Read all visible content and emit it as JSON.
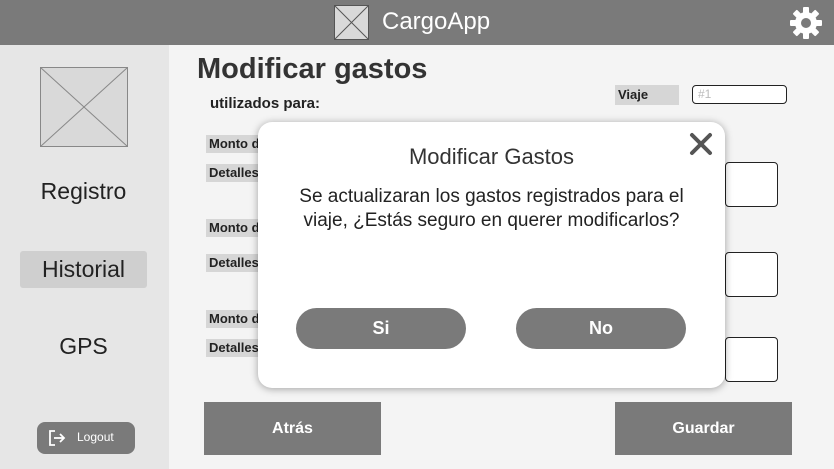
{
  "header": {
    "app_title": "CargoApp",
    "logo_icon": "image-placeholder-icon",
    "settings_icon": "gear-icon"
  },
  "sidebar": {
    "avatar_icon": "image-placeholder-icon",
    "items": [
      {
        "label": "Registro",
        "active": false
      },
      {
        "label": "Historial",
        "active": true
      },
      {
        "label": "GPS",
        "active": false
      }
    ],
    "logout_label": "Logout"
  },
  "main": {
    "title": "Modificar gastos",
    "subtitle": "utilizados para:",
    "viaje_label": "Viaje",
    "viaje_placeholder": "#1",
    "fields": [
      {
        "monto_label": "Monto de",
        "detalles_label": "Detalles"
      },
      {
        "monto_label": "Monto de",
        "detalles_label": "Detalles"
      },
      {
        "monto_label": "Monto de",
        "detalles_label": "Detalles"
      }
    ],
    "back_button": "Atrás",
    "save_button": "Guardar"
  },
  "modal": {
    "title": "Modificar Gastos",
    "message": "Se actualizaran los gastos registrados para el viaje, ¿Estás seguro en querer modificarlos?",
    "yes_button": "Si",
    "no_button": "No"
  },
  "colors": {
    "primary_gray": "#7a7a7a",
    "sidebar_bg": "#e6e6e6",
    "label_bg": "#d6d6d6"
  }
}
